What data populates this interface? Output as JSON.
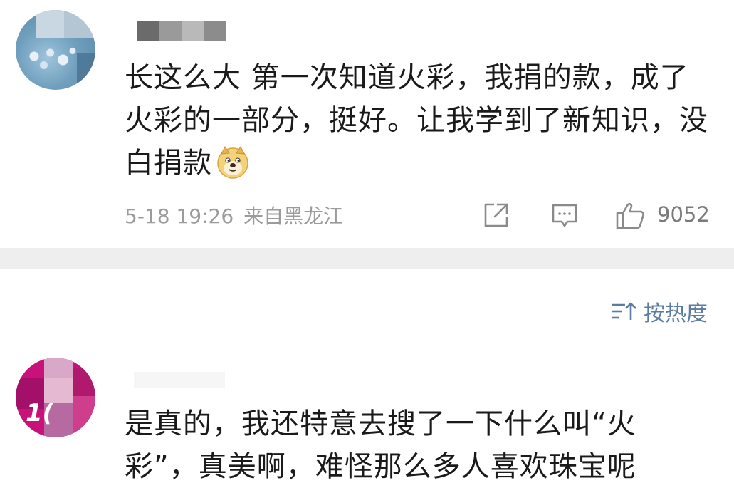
{
  "comment_1": {
    "text": "长这么大 第一次知道火彩，我捐的款，成了火彩的一部分，挺好。让我学到了新知识，没白捐款",
    "emoji": "doge",
    "date": "5-18 19:26",
    "location": "来自黑龙江",
    "like_count": "9052"
  },
  "sort": {
    "label": "按热度"
  },
  "comment_2": {
    "text": "是真的，我还特意去搜了一下什么叫“火彩”，真美啊，难怪那么多人喜欢珠宝呢",
    "avatar_badge": "1("
  },
  "colors": {
    "text": "#1a1a1a",
    "meta": "#9b9b9b",
    "sort_accent": "#5b7ba1",
    "divider": "#eeeeee"
  }
}
